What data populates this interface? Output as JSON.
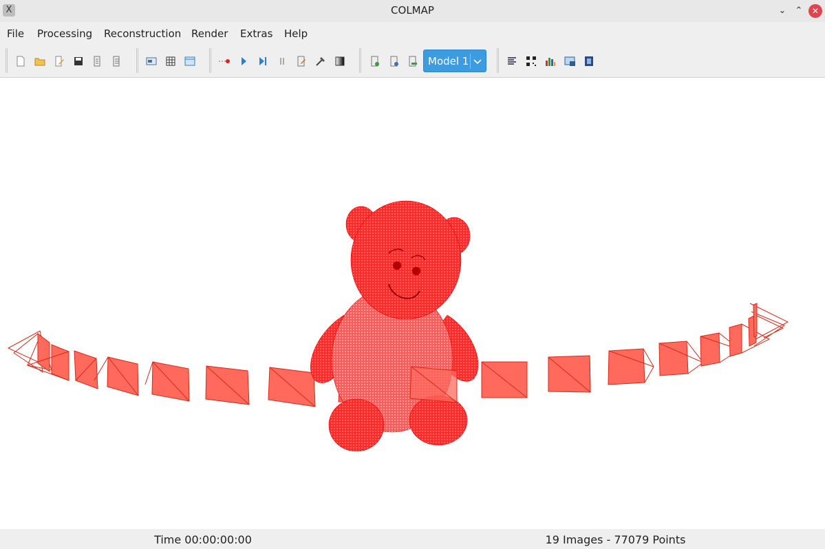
{
  "window": {
    "title": "COLMAP",
    "app_icon_glyph": "X",
    "minimize_glyph": "⌄",
    "maximize_glyph": "⌃",
    "close_glyph": "✕"
  },
  "menu": [
    "File",
    "Processing",
    "Reconstruction",
    "Render",
    "Extras",
    "Help"
  ],
  "toolbar": {
    "model_select": {
      "value": "Model 1 (",
      "chevron_icon": "chevron-down-icon"
    },
    "icons": [
      "new-project-icon",
      "open-project-icon",
      "edit-project-icon",
      "save-project-icon",
      "import-icon",
      "export-icon",
      "feature-extraction-icon",
      "feature-matching-icon",
      "database-icon",
      "auto-reconstruction-icon",
      "start-reconstruction-icon",
      "step-reconstruction-icon",
      "pause-reconstruction-icon",
      "reconstruction-options-icon",
      "bundle-adjustment-icon",
      "dense-reconstruction-icon",
      "model-import-icon",
      "model-export-icon",
      "model-delete-icon",
      "log-icon",
      "grab-image-icon",
      "statistics-icon",
      "render-options-icon",
      "movie-icon"
    ]
  },
  "viewport": {
    "point_color": "#ff0000",
    "camera_fill": "#ff6a5c",
    "camera_stroke": "#d42a1a",
    "object": "point-cloud-teddy-bear",
    "cameras": 19
  },
  "status": {
    "time": "Time 00:00:00:00",
    "count": "19 Images - 77079 Points"
  },
  "colors": {
    "accent": "#3d9be0",
    "close": "#e0454e"
  }
}
